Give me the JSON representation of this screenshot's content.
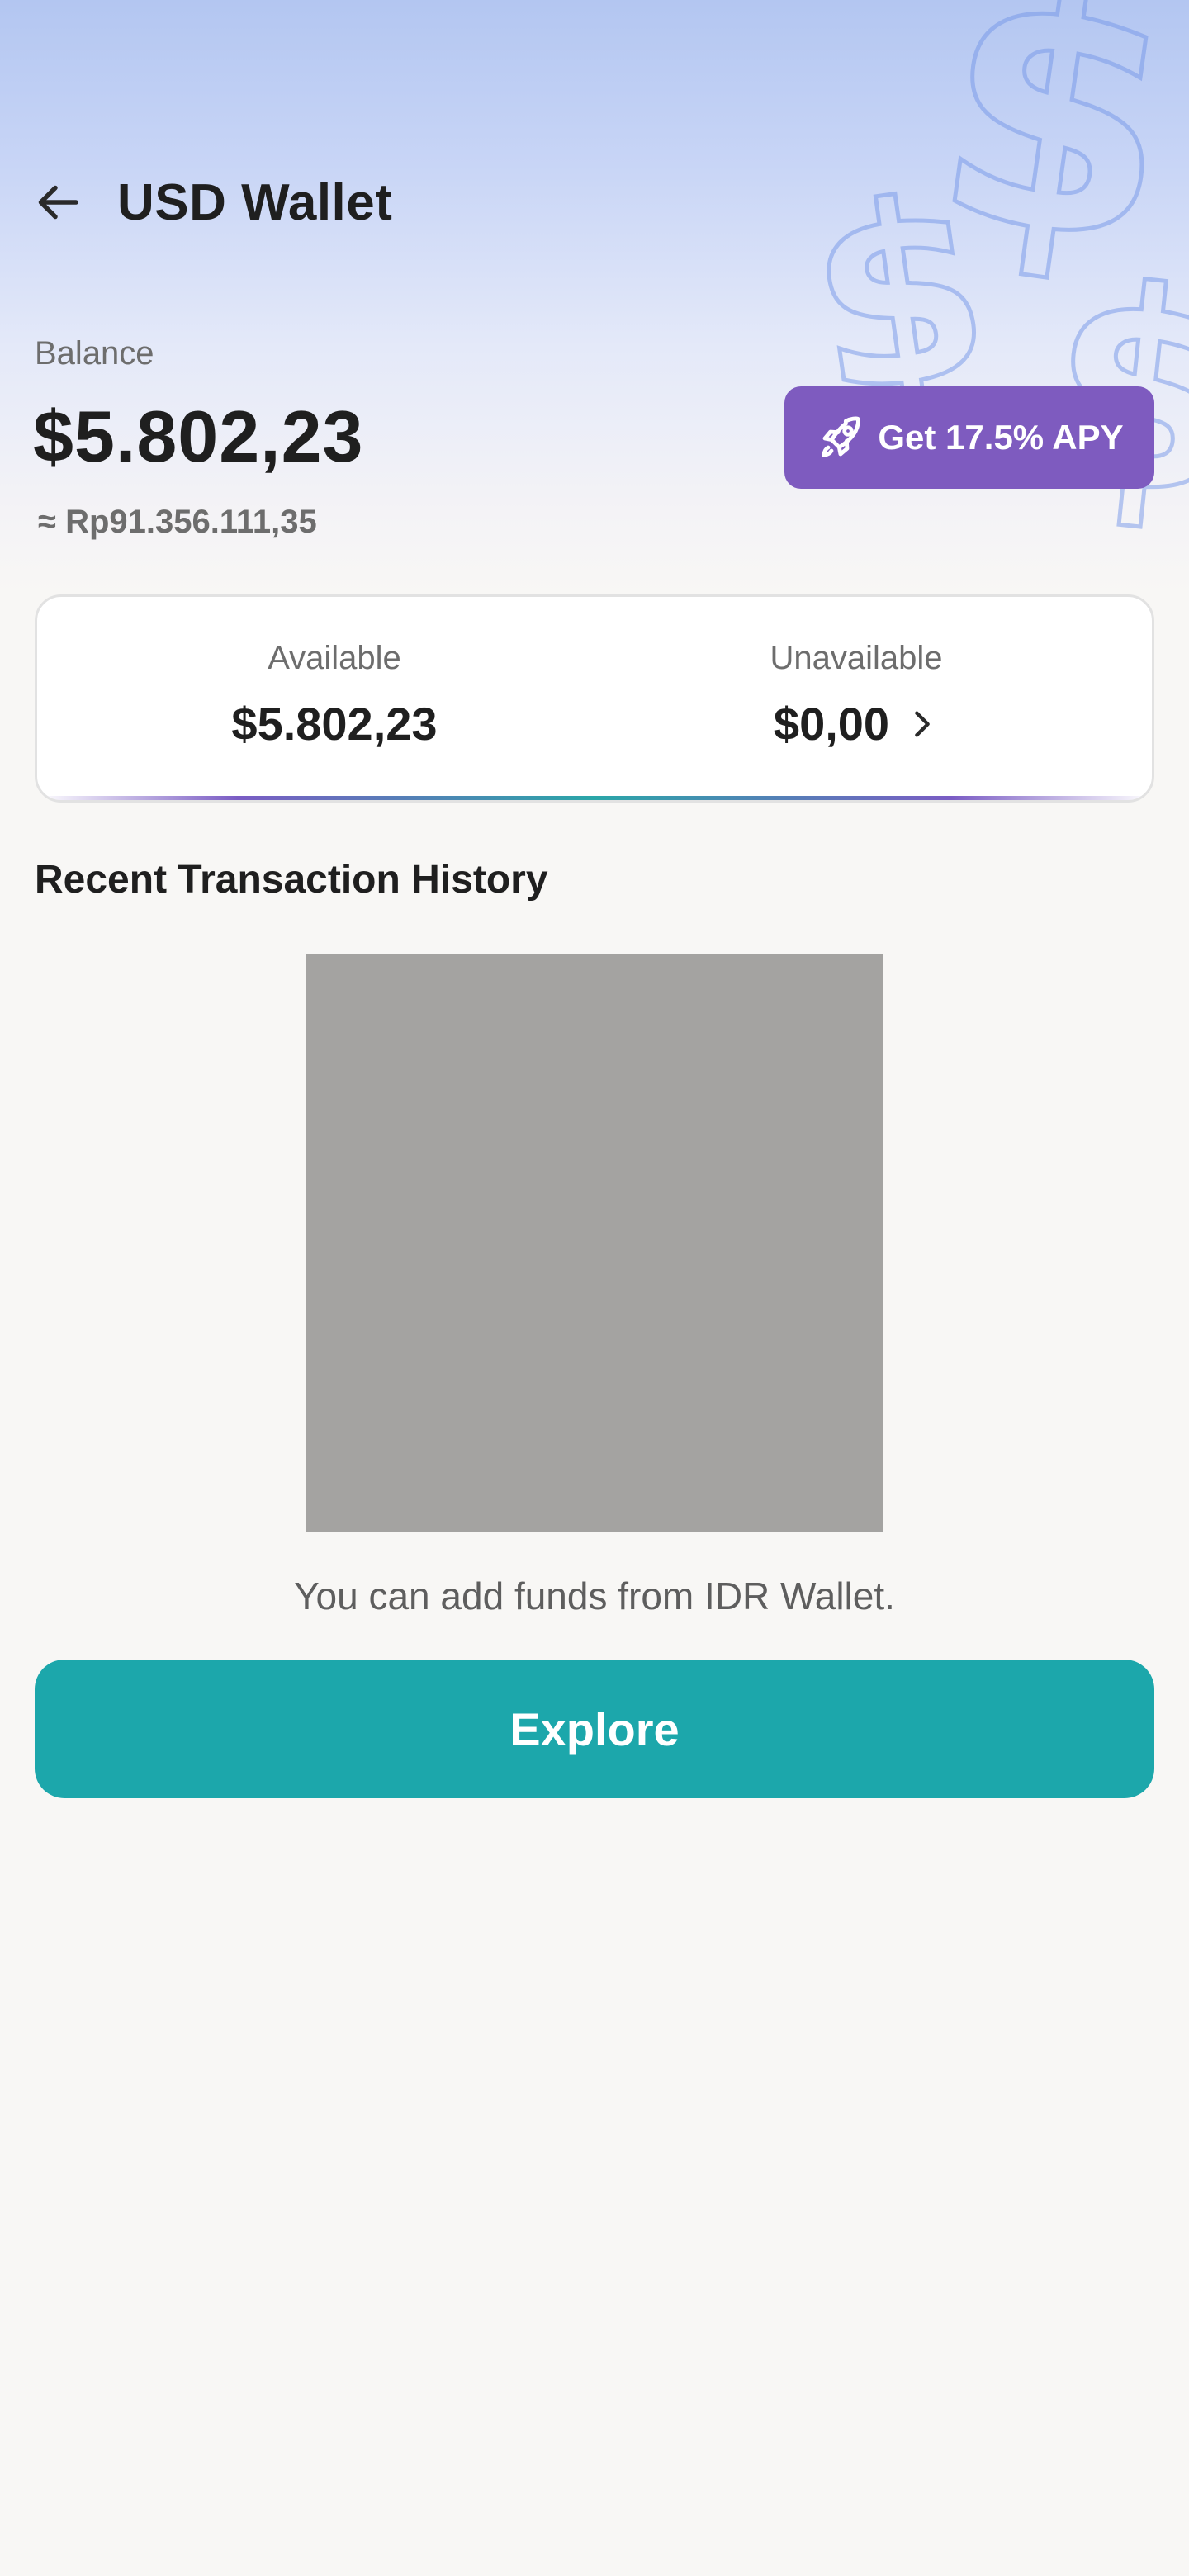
{
  "header": {
    "back_icon": "arrow-left-icon",
    "title": "USD Wallet"
  },
  "balance": {
    "label": "Balance",
    "amount": "$5.802,23",
    "idr_equivalent": "≈ Rp91.356.111,35"
  },
  "apy_button": {
    "icon": "rocket-icon",
    "label": "Get 17.5% APY",
    "color": "#7e5bbf"
  },
  "funds": {
    "available": {
      "label": "Available",
      "value": "$5.802,23"
    },
    "unavailable": {
      "label": "Unavailable",
      "value": "$0,00",
      "icon": "chevron-right-icon"
    }
  },
  "history": {
    "title": "Recent Transaction History",
    "empty_message": "You can add funds from IDR Wallet."
  },
  "explore_button": {
    "label": "Explore",
    "color": "#1ca7ab"
  },
  "decoration": {
    "icon": "dollar-sign-icon",
    "glyph": "$"
  }
}
